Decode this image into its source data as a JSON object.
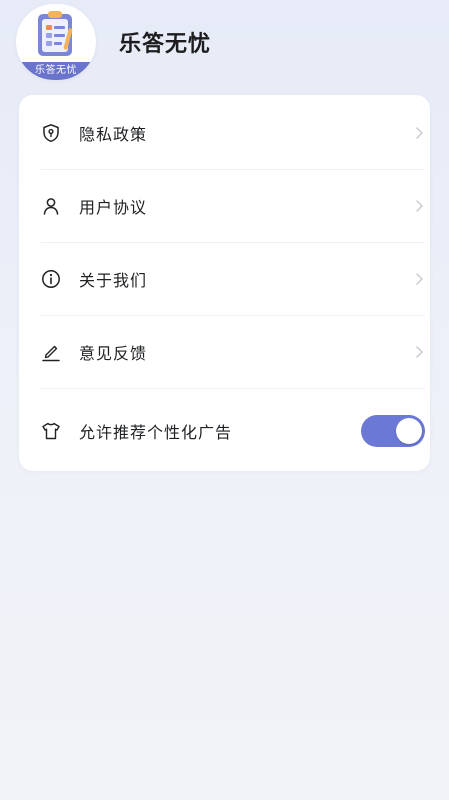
{
  "app": {
    "name": "乐答无忧",
    "logo_text": "乐答无忧",
    "accent_color": "#6b78d6"
  },
  "menu": {
    "items": [
      {
        "label": "隐私政策",
        "icon": "shield-icon"
      },
      {
        "label": "用户协议",
        "icon": "user-icon"
      },
      {
        "label": "关于我们",
        "icon": "info-icon"
      },
      {
        "label": "意见反馈",
        "icon": "pen-icon"
      }
    ],
    "toggle_item": {
      "label": "允许推荐个性化广告",
      "icon": "shirt-icon",
      "enabled": true
    }
  }
}
